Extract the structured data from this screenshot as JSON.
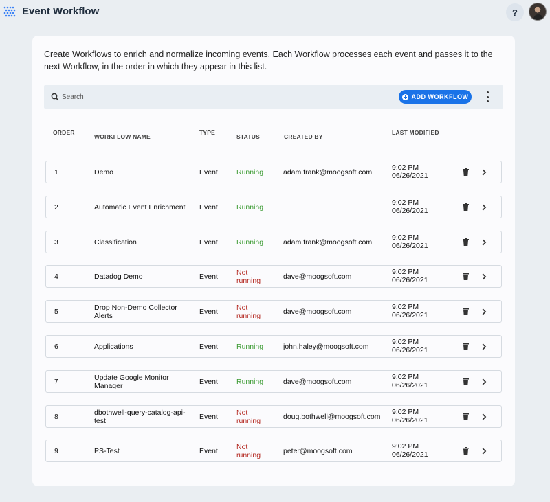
{
  "header": {
    "title": "Event Workflow",
    "help_label": "?"
  },
  "intro_text": "Create Workflows to enrich and normalize incoming events. Each Workflow processes each event and passes it to the next Workflow, in the order in which they appear in this list.",
  "toolbar": {
    "search_placeholder": "Search",
    "add_label": "ADD WORKFLOW",
    "accent_color": "#1a73e8"
  },
  "columns": {
    "order": "ORDER",
    "name": "WORKFLOW NAME",
    "type": "TYPE",
    "status": "STATUS",
    "created_by": "CREATED BY",
    "last_modified": "LAST MODIFIED"
  },
  "status_colors": {
    "running": "#3e9c35",
    "not_running": "#b3261e"
  },
  "rows": [
    {
      "order": "1",
      "name_lines": [
        "Demo"
      ],
      "type": "Event",
      "status_lines": [
        "Running"
      ],
      "running": true,
      "created_by": "adam.frank@moogsoft.com",
      "time": "9:02 PM",
      "date": "06/26/2021"
    },
    {
      "order": "2",
      "name_lines": [
        "Automatic Event Enrichment"
      ],
      "type": "Event",
      "status_lines": [
        "Running"
      ],
      "running": true,
      "created_by": "",
      "time": "9:02 PM",
      "date": "06/26/2021"
    },
    {
      "order": "3",
      "name_lines": [
        "Classification"
      ],
      "type": "Event",
      "status_lines": [
        "Running"
      ],
      "running": true,
      "created_by": "adam.frank@moogsoft.com",
      "time": "9:02 PM",
      "date": "06/26/2021"
    },
    {
      "order": "4",
      "name_lines": [
        "Datadog Demo"
      ],
      "type": "Event",
      "status_lines": [
        "Not",
        "running"
      ],
      "running": false,
      "created_by": "dave@moogsoft.com",
      "time": "9:02 PM",
      "date": "06/26/2021"
    },
    {
      "order": "5",
      "name_lines": [
        "Drop Non-Demo Collector",
        "Alerts"
      ],
      "type": "Event",
      "status_lines": [
        "Not",
        "running"
      ],
      "running": false,
      "created_by": "dave@moogsoft.com",
      "time": "9:02 PM",
      "date": "06/26/2021"
    },
    {
      "order": "6",
      "name_lines": [
        "Applications"
      ],
      "type": "Event",
      "status_lines": [
        "Running"
      ],
      "running": true,
      "created_by": "john.haley@moogsoft.com",
      "time": "9:02 PM",
      "date": "06/26/2021"
    },
    {
      "order": "7",
      "name_lines": [
        "Update Google Monitor",
        "Manager"
      ],
      "type": "Event",
      "status_lines": [
        "Running"
      ],
      "running": true,
      "created_by": "dave@moogsoft.com",
      "time": "9:02 PM",
      "date": "06/26/2021"
    },
    {
      "order": "8",
      "name_lines": [
        "dbothwell-query-catalog-api-",
        "test"
      ],
      "type": "Event",
      "status_lines": [
        "Not",
        "running"
      ],
      "running": false,
      "created_by": "doug.bothwell@moogsoft.com",
      "time": "9:02 PM",
      "date": "06/26/2021"
    },
    {
      "order": "9",
      "name_lines": [
        "PS-Test"
      ],
      "type": "Event",
      "status_lines": [
        "Not",
        "running"
      ],
      "running": false,
      "created_by": "peter@moogsoft.com",
      "time": "9:02 PM",
      "date": "06/26/2021"
    }
  ]
}
